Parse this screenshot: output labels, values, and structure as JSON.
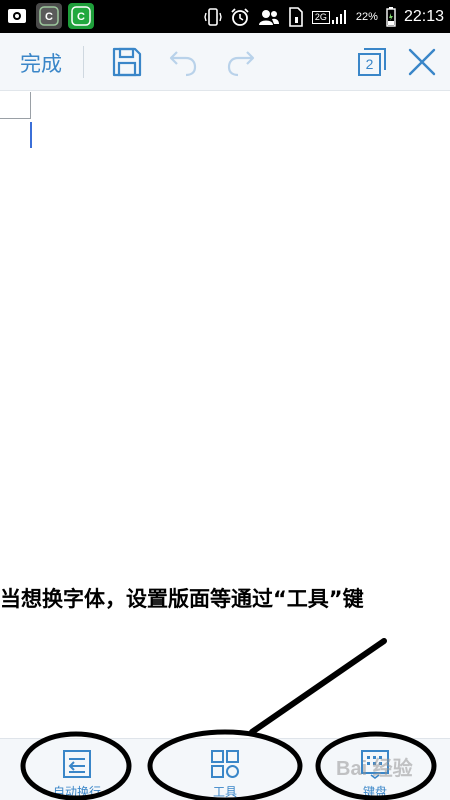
{
  "status_bar": {
    "network": "2G",
    "battery": "22%",
    "time": "22:13"
  },
  "toolbar": {
    "done_label": "完成",
    "page_count": "2"
  },
  "document": {
    "instruction": "当想换字体，设置版面等通过“工具”键"
  },
  "bottom_bar": {
    "items": [
      {
        "label": "自动换行",
        "icon": "wrap-icon"
      },
      {
        "label": "工具",
        "icon": "grid-icon"
      },
      {
        "label": "键盘",
        "icon": "keyboard-icon"
      }
    ]
  },
  "watermark": "Bai 经验",
  "colors": {
    "accent": "#3a86c8",
    "toolbar_bg": "#f4f7fa",
    "status_bg": "#000000"
  }
}
